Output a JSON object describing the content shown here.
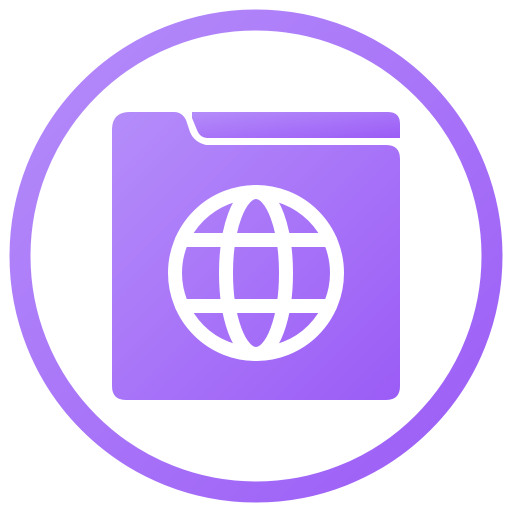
{
  "icon": {
    "name": "web-folder-icon",
    "glyph": "globe-icon",
    "colors": {
      "gradient_start": "#b58dfa",
      "gradient_end": "#9b5cf6",
      "foreground": "#ffffff"
    }
  }
}
